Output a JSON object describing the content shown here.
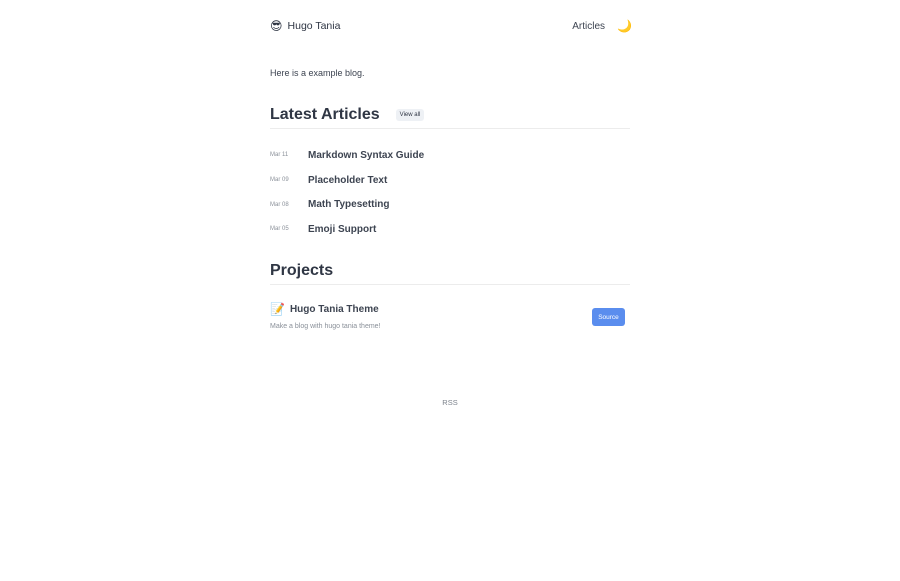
{
  "header": {
    "brand_emoji": "😎",
    "brand_name": "Hugo Tania",
    "nav_articles": "Articles",
    "theme_toggle_emoji": "🌙"
  },
  "intro": {
    "text": "Here is a example blog."
  },
  "latest": {
    "title": "Latest Articles",
    "view_all": "View all",
    "articles": [
      {
        "date": "Mar 11",
        "title": "Markdown Syntax Guide"
      },
      {
        "date": "Mar 09",
        "title": "Placeholder Text"
      },
      {
        "date": "Mar 08",
        "title": "Math Typesetting"
      },
      {
        "date": "Mar 05",
        "title": "Emoji Support"
      }
    ]
  },
  "projects": {
    "title": "Projects",
    "items": [
      {
        "emoji": "📝",
        "title": "Hugo Tania Theme",
        "description": "Make a blog with hugo tania theme!",
        "button": "Source"
      }
    ]
  },
  "footer": {
    "rss": "RSS"
  },
  "colors": {
    "text": "#2f3644",
    "muted": "#8a9099",
    "accent": "#5a8dee",
    "divider": "#ececec"
  }
}
